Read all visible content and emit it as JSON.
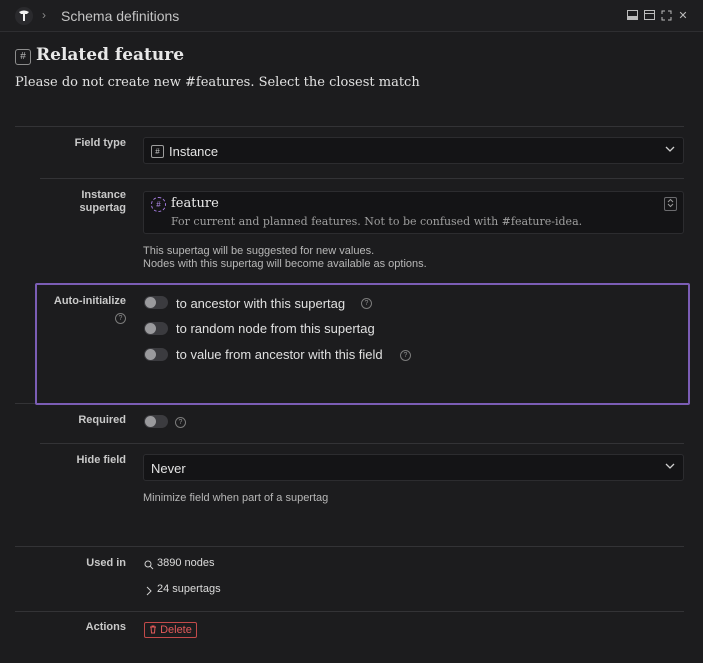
{
  "window": {
    "breadcrumb_sep": "›",
    "title": "Schema definitions",
    "buttons": [
      "panel-bottom-icon",
      "panel-top-icon",
      "expand-icon",
      "close-icon"
    ],
    "close_glyph": "✕"
  },
  "page": {
    "title_icon": "#",
    "title": "Related feature",
    "subtitle": "Please do not create new #features. Select the closest match"
  },
  "field_type": {
    "label": "Field type",
    "icon": "#",
    "value": "Instance"
  },
  "instance_supertag": {
    "label_line1": "Instance",
    "label_line2": "supertag",
    "icon": "#",
    "name": "feature",
    "description": "For current and planned features. Not to be confused with #feature-idea.",
    "help_line1": "This supertag will be suggested for new values.",
    "help_line2": "Nodes with this supertag will become available as options."
  },
  "auto_initialize": {
    "label": "Auto-initialize",
    "options": [
      {
        "label": "to ancestor with this supertag",
        "enabled": false,
        "has_help": true
      },
      {
        "label": "to random node from this supertag",
        "enabled": false,
        "has_help": false
      },
      {
        "label": "to value from ancestor with this field",
        "enabled": false,
        "has_help": true
      }
    ]
  },
  "required": {
    "label": "Required",
    "enabled": false
  },
  "hide_field": {
    "label": "Hide field",
    "value": "Never",
    "help": "Minimize field when part of a supertag"
  },
  "used_in": {
    "label": "Used in",
    "nodes": "3890 nodes",
    "supertags": "24 supertags"
  },
  "actions": {
    "label": "Actions",
    "delete": "Delete"
  },
  "colors": {
    "background": "#1c1c1e",
    "highlight": "#7b5db5",
    "danger": "#e35a5a",
    "supertag": "#b58cef"
  }
}
